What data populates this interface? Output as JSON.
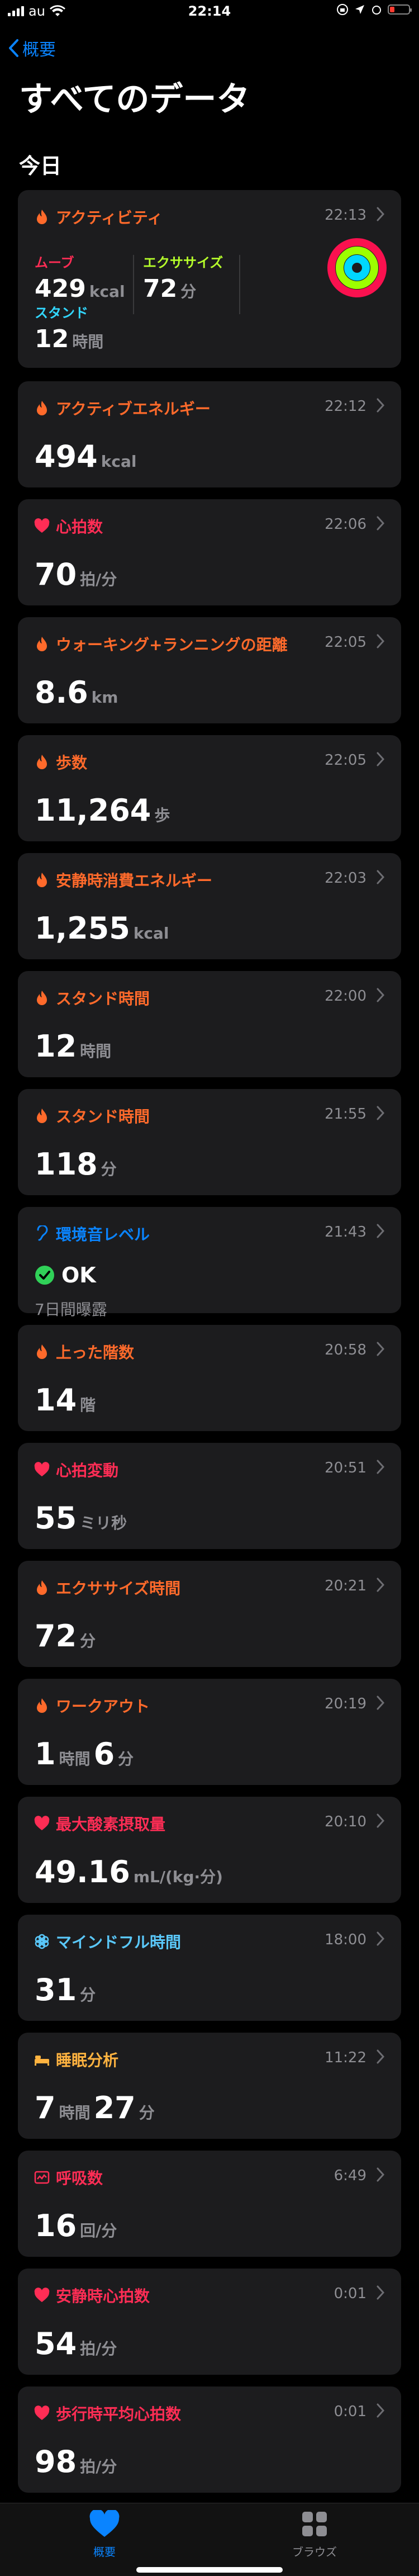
{
  "status_bar": {
    "carrier": "au",
    "time": "22:14"
  },
  "nav": {
    "back_label": "概要"
  },
  "page_title": "すべてのデータ",
  "section_title": "今日",
  "colors": {
    "activity": "#ff6a2b",
    "heart": "#ff2d55",
    "hearing": "#0a84ff",
    "mindful": "#5ac8fa",
    "sleep": "#ffb340",
    "accent": "#0a84ff"
  },
  "activity": {
    "title": "アクティビティ",
    "time": "22:13",
    "move_label": "ムーブ",
    "move_value": "429",
    "move_unit": "kcal",
    "exercise_label": "エクササイズ",
    "exercise_value": "72",
    "exercise_unit": "分",
    "stand_label": "スタンド",
    "stand_value": "12",
    "stand_unit": "時間"
  },
  "cards": [
    {
      "title": "アクティブエネルギー",
      "time": "22:12",
      "icon": "flame-icon",
      "value": "494",
      "unit": "kcal"
    },
    {
      "title": "心拍数",
      "time": "22:06",
      "icon": "heart-icon",
      "value": "70",
      "unit": "拍/分"
    },
    {
      "title": "ウォーキング+ランニングの距離",
      "time": "22:05",
      "icon": "flame-icon",
      "value": "8.6",
      "unit": "km"
    },
    {
      "title": "歩数",
      "time": "22:05",
      "icon": "flame-icon",
      "value": "11,264",
      "unit": "歩"
    },
    {
      "title": "安静時消費エネルギー",
      "time": "22:03",
      "icon": "flame-icon",
      "value": "1,255",
      "unit": "kcal"
    },
    {
      "title": "スタンド時間",
      "time": "22:00",
      "icon": "flame-icon",
      "value": "12",
      "unit": "時間"
    },
    {
      "title": "スタンド時間",
      "time": "21:55",
      "icon": "flame-icon",
      "value": "118",
      "unit": "分"
    },
    {
      "title": "環境音レベル",
      "time": "21:43",
      "icon": "ear-icon",
      "value": "OK",
      "sub": "7日間曝露"
    },
    {
      "title": "上った階数",
      "time": "20:58",
      "icon": "flame-icon",
      "value": "14",
      "unit": "階"
    },
    {
      "title": "心拍変動",
      "time": "20:51",
      "icon": "heart-icon",
      "value": "55",
      "unit": "ミリ秒"
    },
    {
      "title": "エクササイズ時間",
      "time": "20:21",
      "icon": "flame-icon",
      "value": "72",
      "unit": "分"
    },
    {
      "title": "ワークアウト",
      "time": "20:19",
      "icon": "flame-icon",
      "value": "1",
      "unit": "時間",
      "value2": "6",
      "unit2": "分"
    },
    {
      "title": "最大酸素摂取量",
      "time": "20:10",
      "icon": "heart-icon",
      "value": "49.16",
      "unit": "mL/(kg·分)"
    },
    {
      "title": "マインドフル時間",
      "time": "18:00",
      "icon": "mindful-icon",
      "value": "31",
      "unit": "分"
    },
    {
      "title": "睡眠分析",
      "time": "11:22",
      "icon": "bed-icon",
      "value": "7",
      "unit": "時間",
      "value2": "27",
      "unit2": "分"
    },
    {
      "title": "呼吸数",
      "time": "6:49",
      "icon": "lungs-icon",
      "value": "16",
      "unit": "回/分"
    },
    {
      "title": "安静時心拍数",
      "time": "0:01",
      "icon": "heart-icon",
      "value": "54",
      "unit": "拍/分"
    },
    {
      "title": "歩行時平均心拍数",
      "time": "0:01",
      "icon": "heart-icon",
      "value": "98",
      "unit": "拍/分"
    }
  ],
  "tabs": [
    {
      "label": "概要",
      "icon": "heart-icon",
      "active": true
    },
    {
      "label": "ブラウズ",
      "icon": "grid-icon",
      "active": false
    }
  ]
}
